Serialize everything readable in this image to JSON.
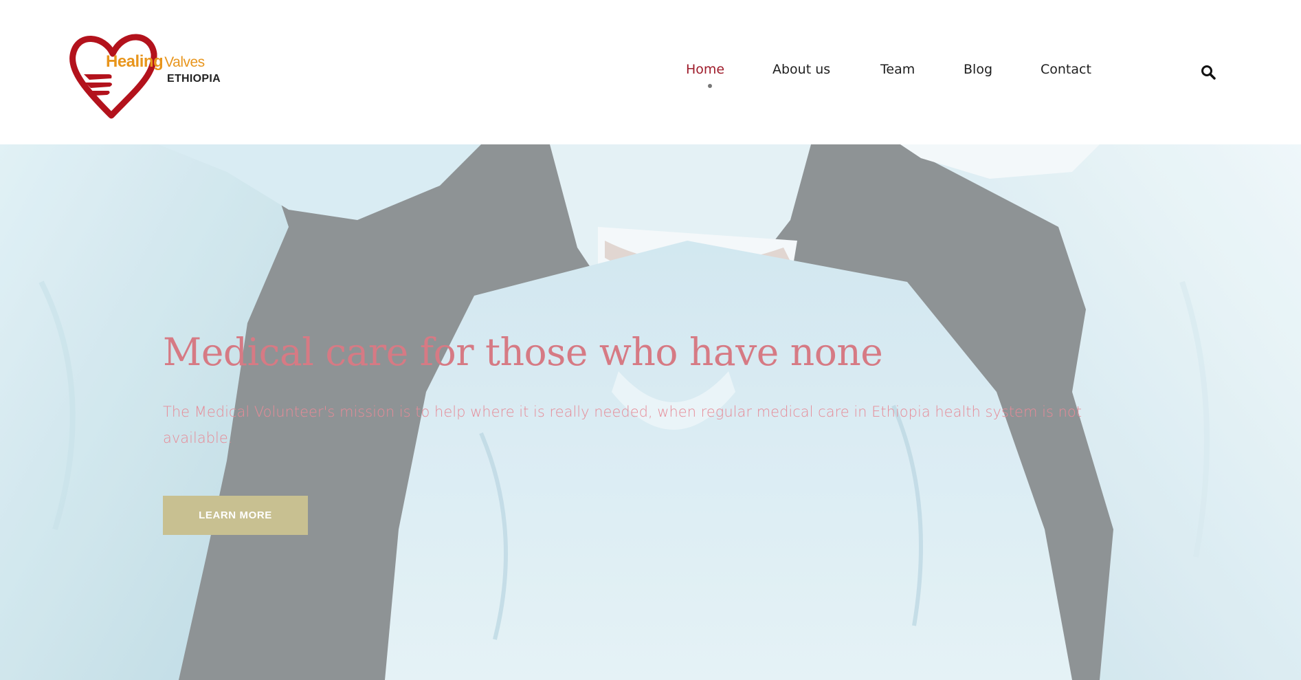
{
  "logo": {
    "word1": "Healing",
    "word2": "Valves",
    "word3": "ETHIOPIA"
  },
  "nav": {
    "items": [
      {
        "label": "Home",
        "active": true
      },
      {
        "label": "About us",
        "active": false
      },
      {
        "label": "Team",
        "active": false
      },
      {
        "label": "Blog",
        "active": false
      },
      {
        "label": "Contact",
        "active": false
      }
    ],
    "search_icon": "search-icon"
  },
  "hero": {
    "title": "Medical care for those who have none",
    "description": "The Medical Volunteer's mission is to help where it is really needed, when regular medical care in Ethiopia health system is not available.",
    "button_label": "LEARN MORE"
  },
  "colors": {
    "accent": "#9e1b2a",
    "hero_title": "#d67a84",
    "hero_text": "#e68b97",
    "button_bg": "#c8c091"
  }
}
